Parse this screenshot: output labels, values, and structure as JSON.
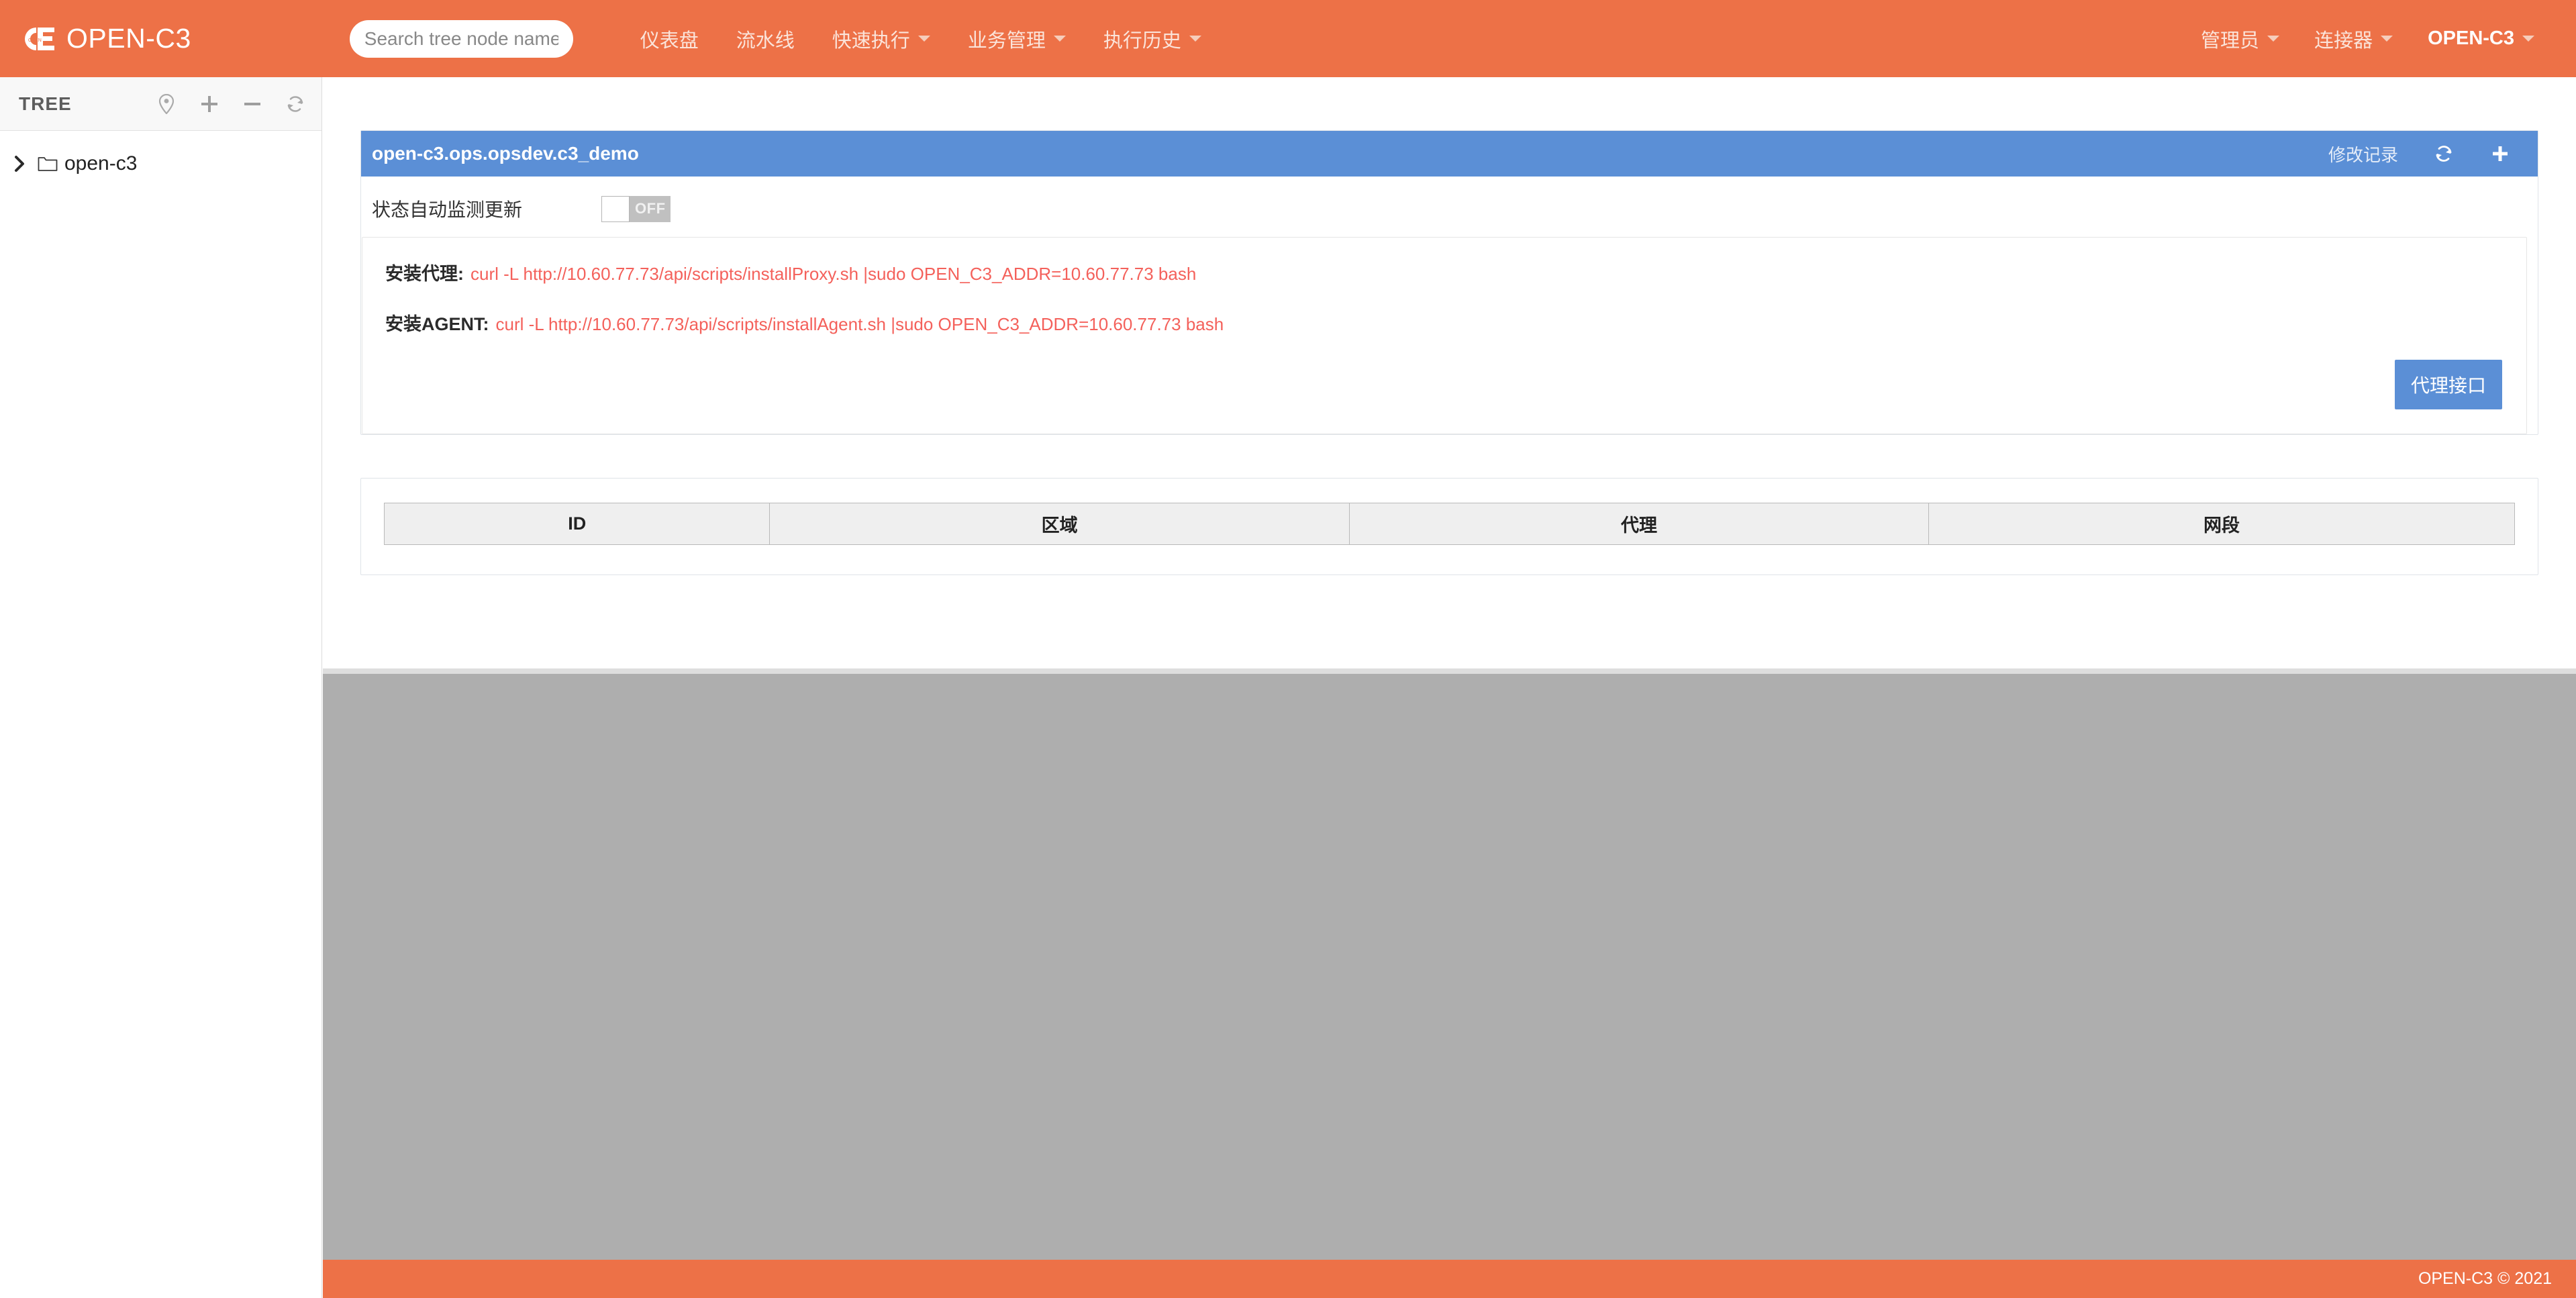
{
  "navbar": {
    "brand": {
      "logo_icon": "c3-logo-icon",
      "name": "OPEN-C3"
    },
    "search": {
      "placeholder": "Search tree node name",
      "value": ""
    },
    "menu": [
      {
        "label": "仪表盘",
        "has_caret": false
      },
      {
        "label": "流水线",
        "has_caret": false
      },
      {
        "label": "快速执行",
        "has_caret": true
      },
      {
        "label": "业务管理",
        "has_caret": true
      },
      {
        "label": "执行历史",
        "has_caret": true
      }
    ],
    "right_menu": [
      {
        "label": "管理员",
        "has_caret": true,
        "strong": false
      },
      {
        "label": "连接器",
        "has_caret": true,
        "strong": false
      },
      {
        "label": "OPEN-C3",
        "has_caret": true,
        "strong": true
      }
    ]
  },
  "sidebar": {
    "title": "TREE",
    "actions": [
      {
        "icon": "location-pin-icon",
        "name": "locate-node-button"
      },
      {
        "icon": "plus-icon",
        "name": "add-node-button"
      },
      {
        "icon": "minus-icon",
        "name": "remove-node-button"
      },
      {
        "icon": "refresh-icon",
        "name": "refresh-tree-button"
      }
    ],
    "tree": [
      {
        "label": "open-c3",
        "expanded": false,
        "icon": "folder-icon"
      }
    ]
  },
  "panel": {
    "title": "open-c3.ops.opsdev.c3_demo",
    "header_actions": {
      "history_link": "修改记录",
      "refresh_icon": "refresh-icon",
      "add_icon": "plus-icon"
    },
    "toggle": {
      "label": "状态自动监测更新",
      "state_text": "OFF",
      "checked": false
    },
    "commands": [
      {
        "label": "安装代理:",
        "value": "curl -L http://10.60.77.73/api/scripts/installProxy.sh |sudo OPEN_C3_ADDR=10.60.77.73 bash"
      },
      {
        "label": "安装AGENT:",
        "value": "curl -L http://10.60.77.73/api/scripts/installAgent.sh |sudo OPEN_C3_ADDR=10.60.77.73 bash"
      }
    ],
    "proxy_button": "代理接口"
  },
  "table": {
    "columns": [
      "ID",
      "区域",
      "代理",
      "网段"
    ],
    "rows": []
  },
  "footer": {
    "text": "OPEN-C3 © 2021"
  },
  "colors": {
    "brand_orange": "#ED7147",
    "panel_blue": "#5B8FD6",
    "command_red": "#F4615B",
    "overlay_gray": "#AEAEAE"
  }
}
